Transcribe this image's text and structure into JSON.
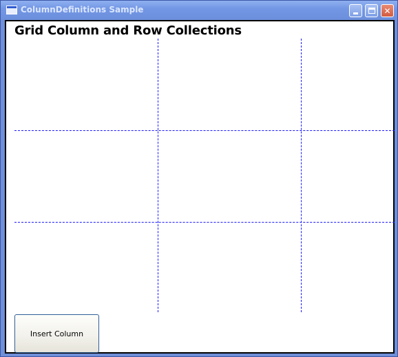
{
  "window": {
    "title": "ColumnDefinitions Sample",
    "title_color": "#dbe6ff",
    "frame_color": "#6f8fd8"
  },
  "titlebar_buttons": {
    "minimize_icon": "minimize-icon",
    "maximize_icon": "maximize-icon",
    "close_icon": "close-icon",
    "close_glyph": "✕"
  },
  "content": {
    "heading": "Grid Column and Row Collections",
    "gridline_colors": [
      "#1a1aff",
      "#d9c200"
    ],
    "grid": {
      "columns": 3,
      "rows": 3
    },
    "insert_button_label": "Insert Column"
  }
}
